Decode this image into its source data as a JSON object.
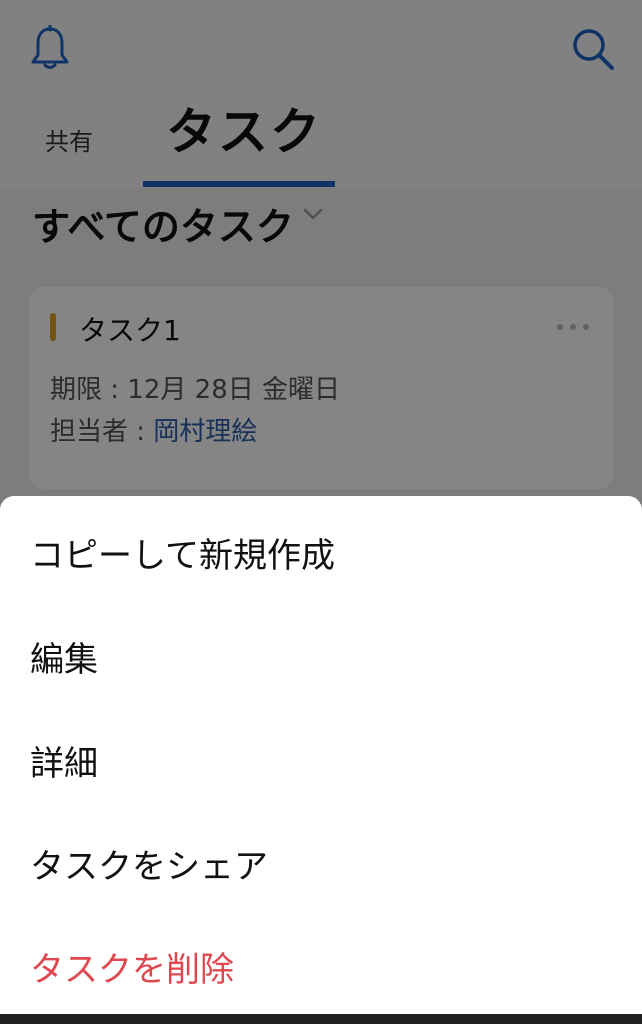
{
  "header": {
    "bell_icon": "bell-icon",
    "search_icon": "search-icon",
    "tabs": [
      {
        "label": "共有"
      },
      {
        "label": "タスク"
      }
    ],
    "active_tab_color": "#1f63c4"
  },
  "filter": {
    "title": "すべてのタスク",
    "chevron_icon": "chevron-down-icon"
  },
  "task_card": {
    "name": "タスク1",
    "priority_color": "#e0a020",
    "due_label": "期限 : ",
    "due_value": "12月 28日 金曜日",
    "assignee_label": "担当者 : ",
    "assignee_value": "岡村理絵",
    "more_icon": "more-horizontal-icon"
  },
  "action_sheet": {
    "items": [
      {
        "label": "コピーして新規作成"
      },
      {
        "label": "編集"
      },
      {
        "label": "詳細"
      },
      {
        "label": "タスクをシェア"
      },
      {
        "label": "タスクを削除",
        "color": "#e0484f"
      }
    ]
  }
}
